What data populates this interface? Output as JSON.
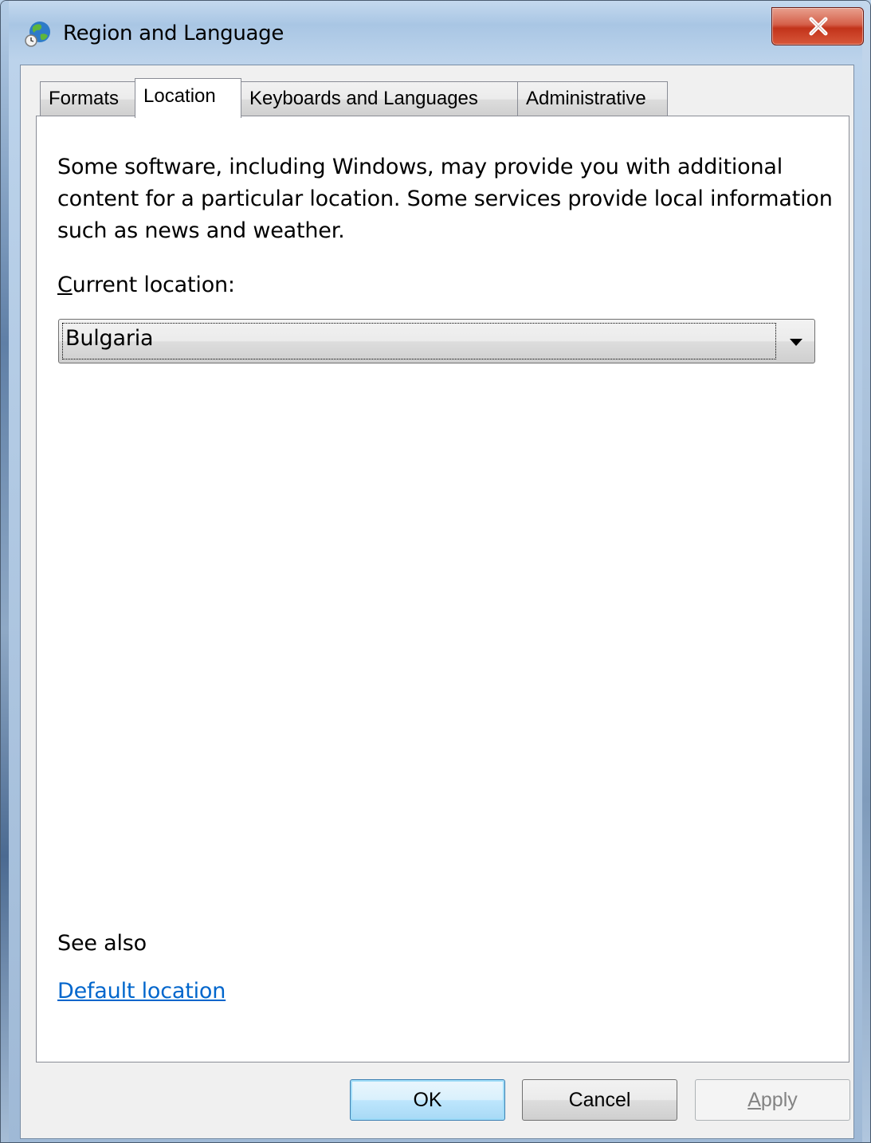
{
  "window": {
    "title": "Region and Language"
  },
  "tabs": [
    {
      "label": "Formats",
      "active": false
    },
    {
      "label": "Location",
      "active": true
    },
    {
      "label": "Keyboards and Languages",
      "active": false
    },
    {
      "label": "Administrative",
      "active": false
    }
  ],
  "location_tab": {
    "description": "Some software, including Windows, may provide you with additional content for a particular location. Some services provide local information such as news and weather.",
    "current_location_label_access_key": "C",
    "current_location_label_rest": "urrent location:",
    "current_location_value": "Bulgaria",
    "see_also_label": "See also",
    "default_location_link": "Default location"
  },
  "buttons": {
    "ok": "OK",
    "cancel": "Cancel",
    "apply_access_key": "A",
    "apply_rest": "pply"
  },
  "icons": {
    "app": "globe-clock-icon",
    "close": "close-icon",
    "dropdown": "chevron-down-icon"
  },
  "colors": {
    "link": "#0066cc",
    "close_button": "#c2331a",
    "ok_button_border": "#3c7fb1"
  }
}
